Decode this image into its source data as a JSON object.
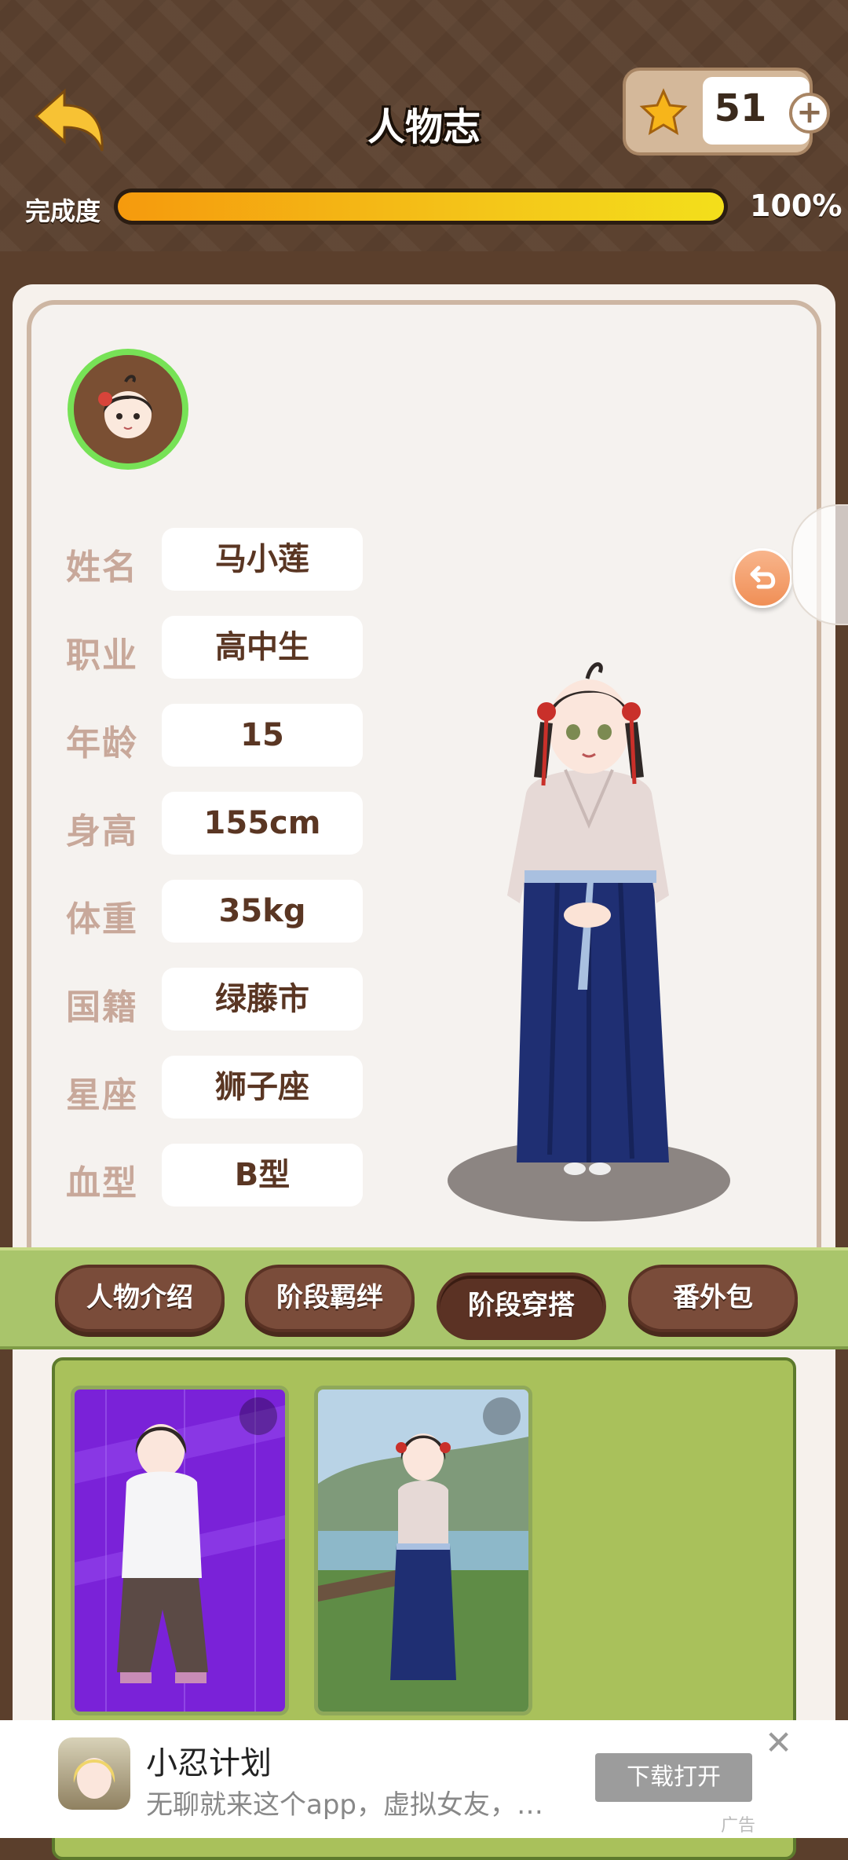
{
  "header": {
    "title": "人物志",
    "stars": "51",
    "plus": "+",
    "progress_label": "完成度",
    "progress_value": 1.0,
    "progress_text": "100%"
  },
  "profile": {
    "fields": [
      {
        "label": "姓名",
        "value": "马小莲"
      },
      {
        "label": "职业",
        "value": "高中生"
      },
      {
        "label": "年龄",
        "value": "15"
      },
      {
        "label": "身高",
        "value": "155cm"
      },
      {
        "label": "体重",
        "value": "35kg"
      },
      {
        "label": "国籍",
        "value": "绿藤市"
      },
      {
        "label": "星座",
        "value": "狮子座"
      },
      {
        "label": "血型",
        "value": "B型"
      }
    ]
  },
  "tabs": [
    {
      "label": "人物介绍",
      "active": false
    },
    {
      "label": "阶段羁绊",
      "active": false
    },
    {
      "label": "阶段穿搭",
      "active": true
    },
    {
      "label": "番外包",
      "active": false
    }
  ],
  "ad": {
    "title": "小忍计划",
    "description": "无聊就来这个app，虚拟女友，…",
    "button": "下载打开",
    "close": "✕",
    "tag": "广告"
  },
  "colors": {
    "header_bg": "#5c4230",
    "accent_green": "#a9c56b",
    "tab_brown": "#7a4c3a",
    "progress_orange": "#f59a0d",
    "progress_yellow": "#f3df1b"
  },
  "icons": [
    "back-arrow-icon",
    "star-icon",
    "plus-icon",
    "undo-icon",
    "expand-icon",
    "close-icon"
  ]
}
